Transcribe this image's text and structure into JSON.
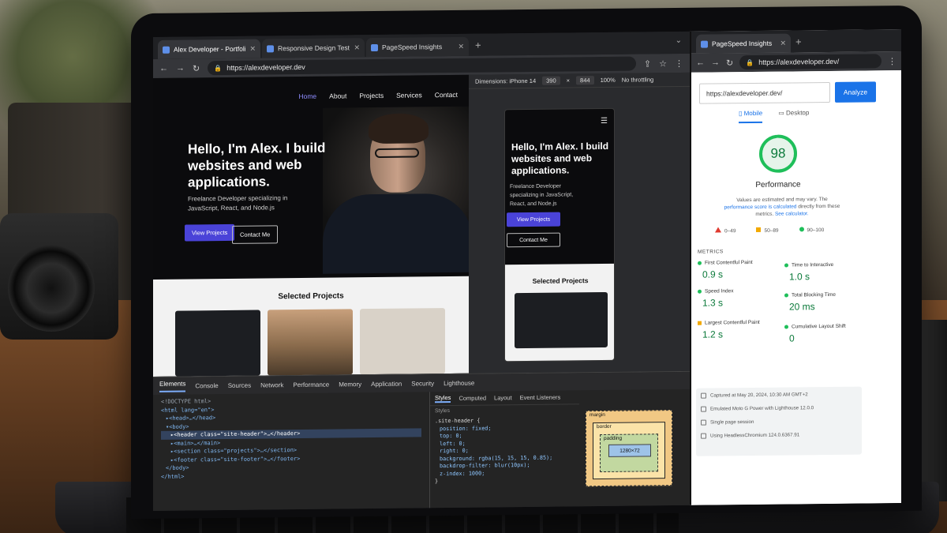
{
  "main_browser": {
    "tabs": [
      {
        "title": "Alex Developer - Portfolio",
        "active": true
      },
      {
        "title": "Responsive Design Test - Mobile",
        "active": false
      },
      {
        "title": "PageSpeed Insights",
        "active": false
      }
    ],
    "url": "https://alexdeveloper.dev"
  },
  "portfolio": {
    "nav": [
      "Home",
      "About",
      "Projects",
      "Services",
      "Contact"
    ],
    "hero_title": "Hello, I'm Alex. I build websites and web applications.",
    "hero_subtitle": "Freelance Developer specializing in JavaScript, React, and Node.js",
    "primary_button": "View Projects",
    "secondary_button": "Contact Me",
    "projects_title": "Selected Projects"
  },
  "device_toolbar": {
    "dimensions_label": "Dimensions: iPhone 14",
    "width": "390",
    "times": "×",
    "height": "844",
    "zoom": "100%",
    "throttling": "No throttling"
  },
  "mobile_preview": {
    "hero_title": "Hello, I'm Alex. I build websites and web applications.",
    "hero_subtitle": "Freelance Developer specializing in JavaScript, React, and Node.js",
    "primary_button": "View Projects",
    "secondary_button": "Contact Me",
    "projects_title": "Selected Projects"
  },
  "devtools": {
    "tabs": [
      "Elements",
      "Console",
      "Sources",
      "Network",
      "Performance",
      "Memory",
      "Application",
      "Security",
      "Lighthouse"
    ],
    "dom_lines": [
      "<!DOCTYPE html>",
      "<html lang=\"en\">",
      "▸<head>…</head>",
      "▾<body>",
      "▸<header class=\"site-header\">…</header>",
      "▸<main>…</main>",
      "▸<section class=\"projects\">…</section>",
      "▸<footer class=\"site-footer\">…</footer>",
      "</body>",
      "</html>"
    ],
    "styles_tabs": [
      "Styles",
      "Computed",
      "Layout",
      "Event Listeners"
    ],
    "styles_filter": "Styles",
    "css_selector": ".site-header {",
    "css_props": [
      "position: fixed;",
      "top: 0;",
      "left: 0;",
      "right: 0;",
      "background: rgba(15, 15, 15, 0.85);",
      "backdrop-filter: blur(10px);",
      "z-index: 1000;"
    ],
    "css_close": "}",
    "box_model": {
      "margin": "margin",
      "border": "border",
      "padding": "padding",
      "content": "1280×72"
    }
  },
  "psi_browser": {
    "tab_title": "PageSpeed Insights",
    "url": "https://alexdeveloper.dev/"
  },
  "psi": {
    "input_url": "https://alexdeveloper.dev/",
    "analyze_button": "Analyze",
    "modes": [
      "Mobile",
      "Desktop"
    ],
    "score": 98,
    "score_label": "Performance",
    "note_line1": "Values are estimated and may vary. The",
    "note_link": "performance score is calculated",
    "note_line2": "directly from these metrics.",
    "note_calc": "See calculator.",
    "legend": [
      "0–49",
      "50–89",
      "90–100"
    ],
    "metrics_heading": "METRICS",
    "metrics": [
      {
        "name": "First Contentful Paint",
        "value": "0.9 s",
        "status": "good"
      },
      {
        "name": "Time to Interactive",
        "value": "1.0 s",
        "status": "good"
      },
      {
        "name": "Speed Index",
        "value": "1.3 s",
        "status": "good"
      },
      {
        "name": "Total Blocking Time",
        "value": "20 ms",
        "status": "good"
      },
      {
        "name": "Largest Contentful Paint",
        "value": "1.2 s",
        "status": "average"
      },
      {
        "name": "Cumulative Layout Shift",
        "value": "0",
        "status": "good"
      }
    ],
    "info": [
      "Captured at May 20, 2024, 10:30 AM GMT+2",
      "Emulated Moto G Power with Lighthouse 12.0.0",
      "Single page session",
      "Using HeadlessChromium 124.0.6367.91"
    ]
  },
  "colors": {
    "accent": "#4a43d8",
    "analyze": "#1a73e8",
    "good": "#1fbf5a",
    "average": "#f2a900",
    "poor": "#e03a2f"
  }
}
